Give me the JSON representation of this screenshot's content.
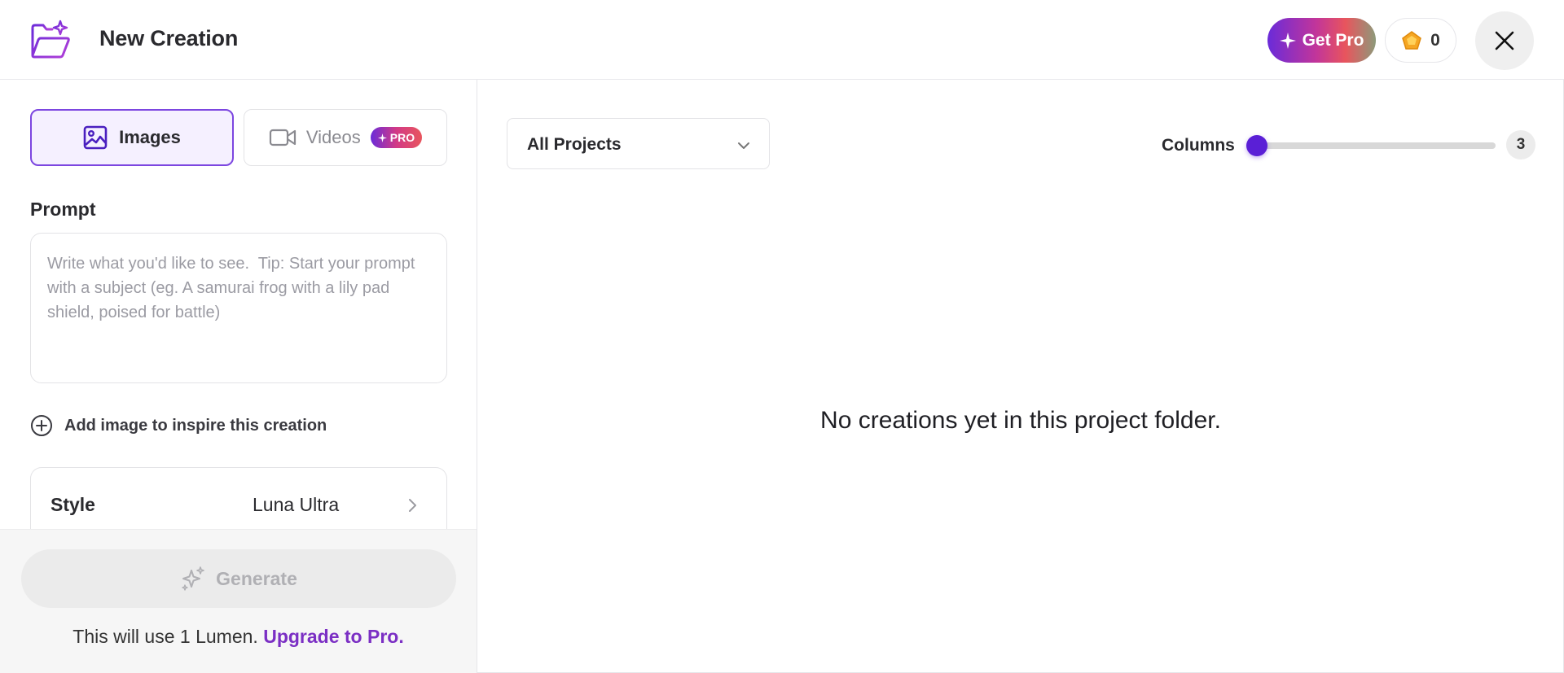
{
  "header": {
    "title": "New Creation",
    "get_pro_label": "Get Pro",
    "lumens_count": "0"
  },
  "tabs": {
    "images_label": "Images",
    "videos_label": "Videos",
    "pro_badge": "PRO"
  },
  "prompt": {
    "label": "Prompt",
    "placeholder": "Write what you'd like to see.  Tip: Start your prompt with a subject (eg. A samurai frog with a lily pad shield, poised for battle)",
    "value": ""
  },
  "add_image_label": "Add image to inspire this creation",
  "style": {
    "label": "Style",
    "value": "Luna Ultra"
  },
  "generate": {
    "label": "Generate",
    "note": "This will use 1 Lumen.",
    "upgrade_link": "Upgrade to Pro."
  },
  "main": {
    "project_filter": "All Projects",
    "columns_label": "Columns",
    "columns_value": "3",
    "empty_message": "No creations yet in this project folder."
  },
  "colors": {
    "accent": "#5a1fd6",
    "tab_active_border": "#7c46e0",
    "upgrade_link": "#7b2fc4"
  },
  "icons": {
    "app": "folder-sparkle-icon",
    "get_pro": "sparkle-icon",
    "lumens": "gem-icon",
    "close": "close-icon",
    "images": "image-icon",
    "videos": "video-camera-icon",
    "add_image": "plus-circle-icon",
    "style": "chevron-right-icon",
    "generate": "sparkle-icon",
    "projects": "chevron-down-icon"
  }
}
